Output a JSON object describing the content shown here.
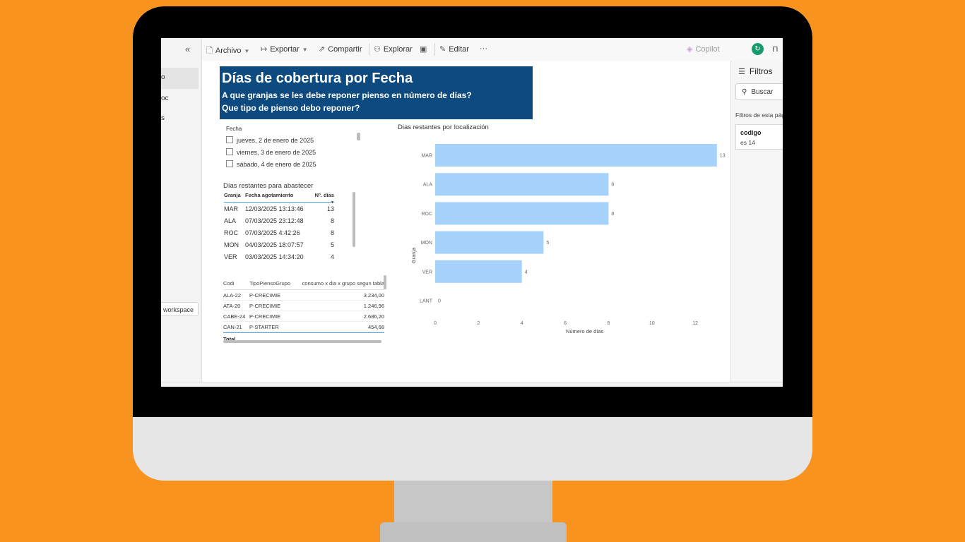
{
  "toolbar": {
    "archivo": "Archivo",
    "exportar": "Exportar",
    "compartir": "Compartir",
    "explorar": "Explorar",
    "editar": "Editar",
    "more": "···",
    "copilot": "Copilot"
  },
  "nav": {
    "collapse": "«",
    "fragment_1": "o",
    "fragment_2": "oc",
    "fragment_3": "s",
    "workspace": "workspace"
  },
  "report": {
    "title": "Días de cobertura por Fecha",
    "subtitle1": "A que granjas se les debe reponer pienso en número de días?",
    "subtitle2": "Que tipo de pienso debo reponer?"
  },
  "slicer": {
    "title": "Fecha",
    "items": [
      "jueves, 2 de enero de 2025",
      "viernes, 3 de enero de 2025",
      "sábado, 4 de enero de 2025"
    ]
  },
  "table1": {
    "title": "Días restantes para abastecer",
    "headers": [
      "Granja",
      "Fecha agotamiento",
      "Nº. días"
    ],
    "sort_indicator": "▼",
    "rows": [
      [
        "MAR",
        "12/03/2025 13:13:46",
        "13"
      ],
      [
        "ALA",
        "07/03/2025 23:12:48",
        "8"
      ],
      [
        "ROC",
        "07/03/2025 4:42:26",
        "8"
      ],
      [
        "MON",
        "04/03/2025 18:07:57",
        "5"
      ],
      [
        "VER",
        "03/03/2025 14:34:20",
        "4"
      ]
    ]
  },
  "table2": {
    "headers": [
      "Codi",
      "TipoPiensoGrupo",
      "consumo x dia x grupo segun tabla"
    ],
    "rows": [
      [
        "ALA-22",
        "P-CRECIMIE",
        "3.234,00"
      ],
      [
        "ATA-20",
        "P-CRECIMIE",
        "1.246,96"
      ],
      [
        "CABE-24",
        "P-CRECIMIE",
        "2.686,20"
      ],
      [
        "CAN-21",
        "P-STARTER",
        "454,68"
      ]
    ],
    "total_label": "Total"
  },
  "chart_data": {
    "type": "bar",
    "orientation": "horizontal",
    "title": "Dias restantes por localización",
    "xlabel": "Número de días",
    "ylabel": "Granja",
    "categories": [
      "MAR",
      "ALA",
      "ROC",
      "MON",
      "VER",
      "LANT"
    ],
    "values": [
      13,
      8,
      8,
      5,
      4,
      0
    ],
    "data_labels": [
      "13",
      "8",
      "8",
      "5",
      "4",
      "0"
    ],
    "xlim": [
      0,
      13.3
    ],
    "xticks": [
      0,
      2,
      4,
      6,
      8,
      10,
      12
    ],
    "bar_color": "#a6d1fa",
    "grid": false,
    "legend": "none"
  },
  "filters": {
    "title": "Filtros",
    "search_placeholder": "Buscar",
    "section": "Filtros de esta pág",
    "card_field": "codigo",
    "card_value": "es 14"
  },
  "colors": {
    "background": "#f7931e",
    "banner": "#0c4a80",
    "accent": "#4ea0d8",
    "avatar": "#1a9b6c"
  }
}
